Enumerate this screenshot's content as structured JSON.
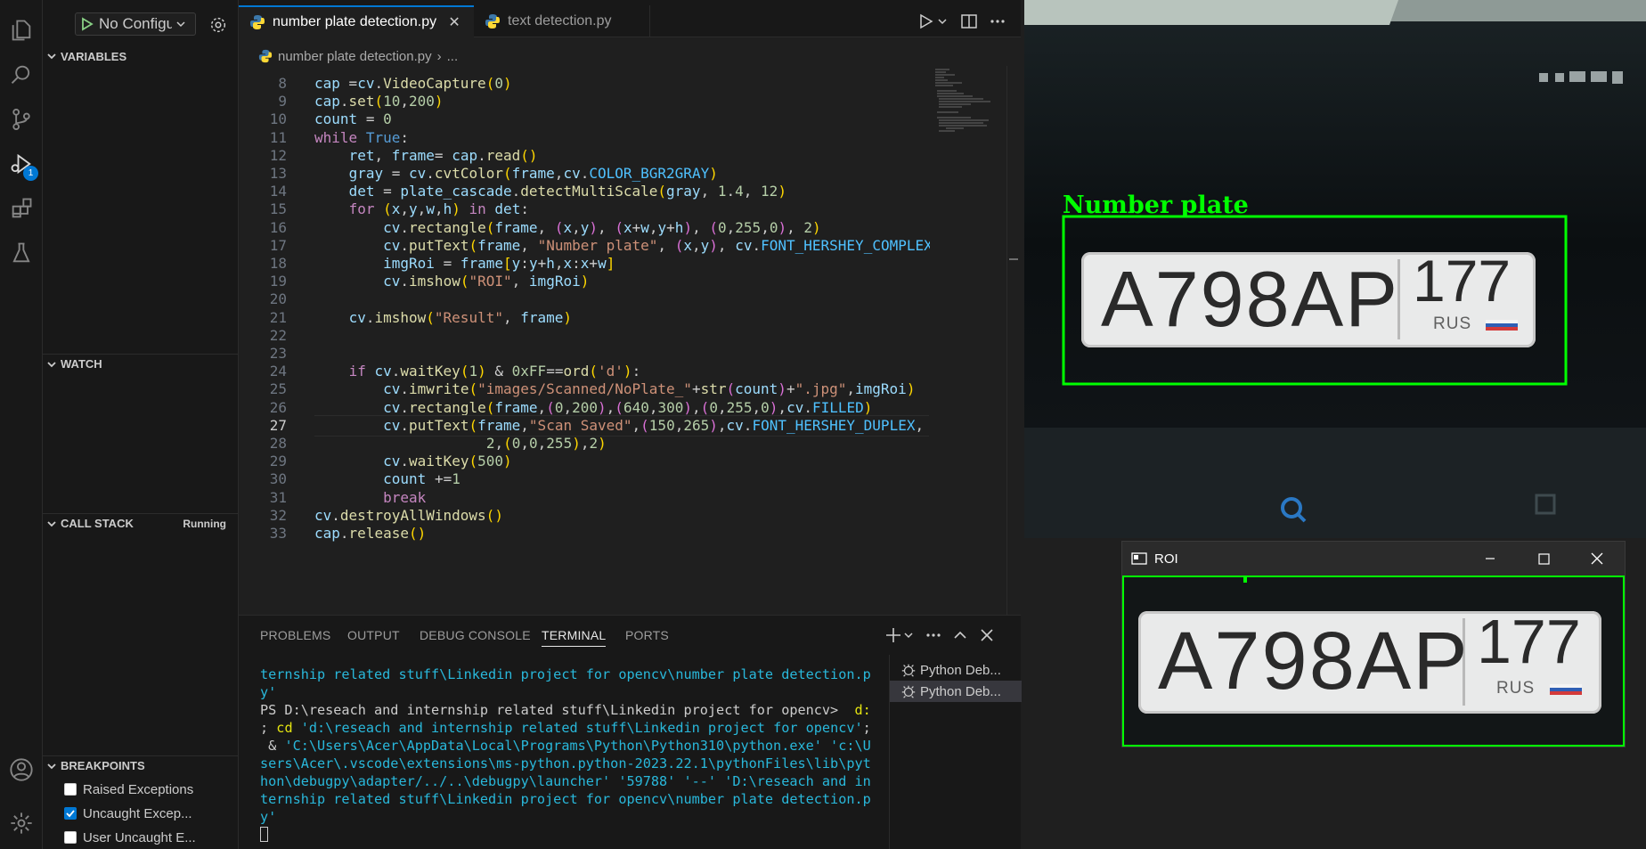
{
  "debug": {
    "run_config": "No Configu",
    "sections": {
      "variables": "VARIABLES",
      "watch": "WATCH",
      "call_stack": "CALL STACK",
      "call_stack_status": "Running",
      "breakpoints": "BREAKPOINTS"
    },
    "breakpoints": [
      {
        "label": "Raised Exceptions",
        "checked": false
      },
      {
        "label": "Uncaught Excep...",
        "checked": true
      },
      {
        "label": "User Uncaught E...",
        "checked": false
      }
    ],
    "debug_badge": "1"
  },
  "editor": {
    "tabs": [
      {
        "label": "number plate detection.py",
        "active": true
      },
      {
        "label": "text detection.py",
        "active": false
      }
    ],
    "breadcrumb": {
      "file": "number plate detection.py",
      "rest": "..."
    },
    "current_line": "27",
    "line_numbers": [
      "8",
      "9",
      "10",
      "11",
      "12",
      "13",
      "14",
      "15",
      "16",
      "17",
      "18",
      "19",
      "20",
      "21",
      "22",
      "23",
      "24",
      "25",
      "26",
      "27",
      "28",
      "29",
      "30",
      "31",
      "32",
      "33"
    ],
    "code_lines": [
      "cap =cv.VideoCapture(0)",
      "cap.set(10,200)",
      "count = 0",
      "while True:",
      "    ret, frame= cap.read()",
      "    gray = cv.cvtColor(frame,cv.COLOR_BGR2GRAY)",
      "    det = plate_cascade.detectMultiScale(gray, 1.4, 12)",
      "    for (x,y,w,h) in det:",
      "        cv.rectangle(frame, (x,y), (x+w,y+h), (0,255,0), 2)",
      "        cv.putText(frame, \"Number plate\", (x,y), cv.FONT_HERSHEY_COMPLEX",
      "        imgRoi = frame[y:y+h,x:x+w]",
      "        cv.imshow(\"ROI\", imgRoi)",
      "",
      "    cv.imshow(\"Result\", frame)",
      "",
      "",
      "    if cv.waitKey(1) & 0xFF==ord('d'):",
      "        cv.imwrite(\"images/Scanned/NoPlate_\"+str(count)+\".jpg\",imgRoi)",
      "        cv.rectangle(frame,(0,200),(640,300),(0,255,0),cv.FILLED)",
      "        cv.putText(frame,\"Scan Saved\",(150,265),cv.FONT_HERSHEY_DUPLEX,",
      "                    2,(0,0,255),2)",
      "        cv.waitKey(500)",
      "        count +=1",
      "        break",
      "cv.destroyAllWindows()",
      "cap.release()"
    ]
  },
  "panel": {
    "tabs": [
      "PROBLEMS",
      "OUTPUT",
      "DEBUG CONSOLE",
      "TERMINAL",
      "PORTS"
    ],
    "active_tab": "TERMINAL",
    "terminal_lines": [
      {
        "parts": [
          {
            "c": "tblue",
            "t": "ternship related stuff\\Linkedin project for opencv\\number plate detection.p"
          }
        ]
      },
      {
        "parts": [
          {
            "c": "tblue",
            "t": "y'"
          }
        ]
      },
      {
        "parts": [
          {
            "c": "twhite",
            "t": "PS D:\\reseach and internship related stuff\\Linkedin project for opencv>  "
          },
          {
            "c": "tyellow",
            "t": "d:"
          }
        ]
      },
      {
        "parts": [
          {
            "c": "twhite",
            "t": "; "
          },
          {
            "c": "tyellow",
            "t": "cd "
          },
          {
            "c": "tblue",
            "t": "'d:\\reseach and internship related stuff\\Linkedin project for opencv'"
          },
          {
            "c": "twhite",
            "t": ";"
          }
        ]
      },
      {
        "parts": [
          {
            "c": "twhite",
            "t": " & "
          },
          {
            "c": "tblue",
            "t": "'C:\\Users\\Acer\\AppData\\Local\\Programs\\Python\\Python310\\python.exe' 'c:\\U"
          }
        ]
      },
      {
        "parts": [
          {
            "c": "tblue",
            "t": "sers\\Acer\\.vscode\\extensions\\ms-python.python-2023.22.1\\pythonFiles\\lib\\pyt"
          }
        ]
      },
      {
        "parts": [
          {
            "c": "tblue",
            "t": "hon\\debugpy\\adapter/../..\\debugpy\\launcher' '59788' '--' 'D:\\reseach and in"
          }
        ]
      },
      {
        "parts": [
          {
            "c": "tblue",
            "t": "ternship related stuff\\Linkedin project for opencv\\number plate detection.p"
          }
        ]
      },
      {
        "parts": [
          {
            "c": "tblue",
            "t": "y'"
          }
        ]
      }
    ],
    "terminals": [
      "Python Deb...",
      "Python Deb..."
    ]
  },
  "result_window": {
    "label": "Number plate",
    "plate_number": "A798AP",
    "plate_region": "177",
    "plate_country": "RUS"
  },
  "roi_window": {
    "title": "ROI",
    "plate_number": "A798AP",
    "plate_region": "177",
    "plate_country": "RUS"
  },
  "colors": {
    "accent": "#0078d4",
    "detect_box": "#00ff00"
  }
}
